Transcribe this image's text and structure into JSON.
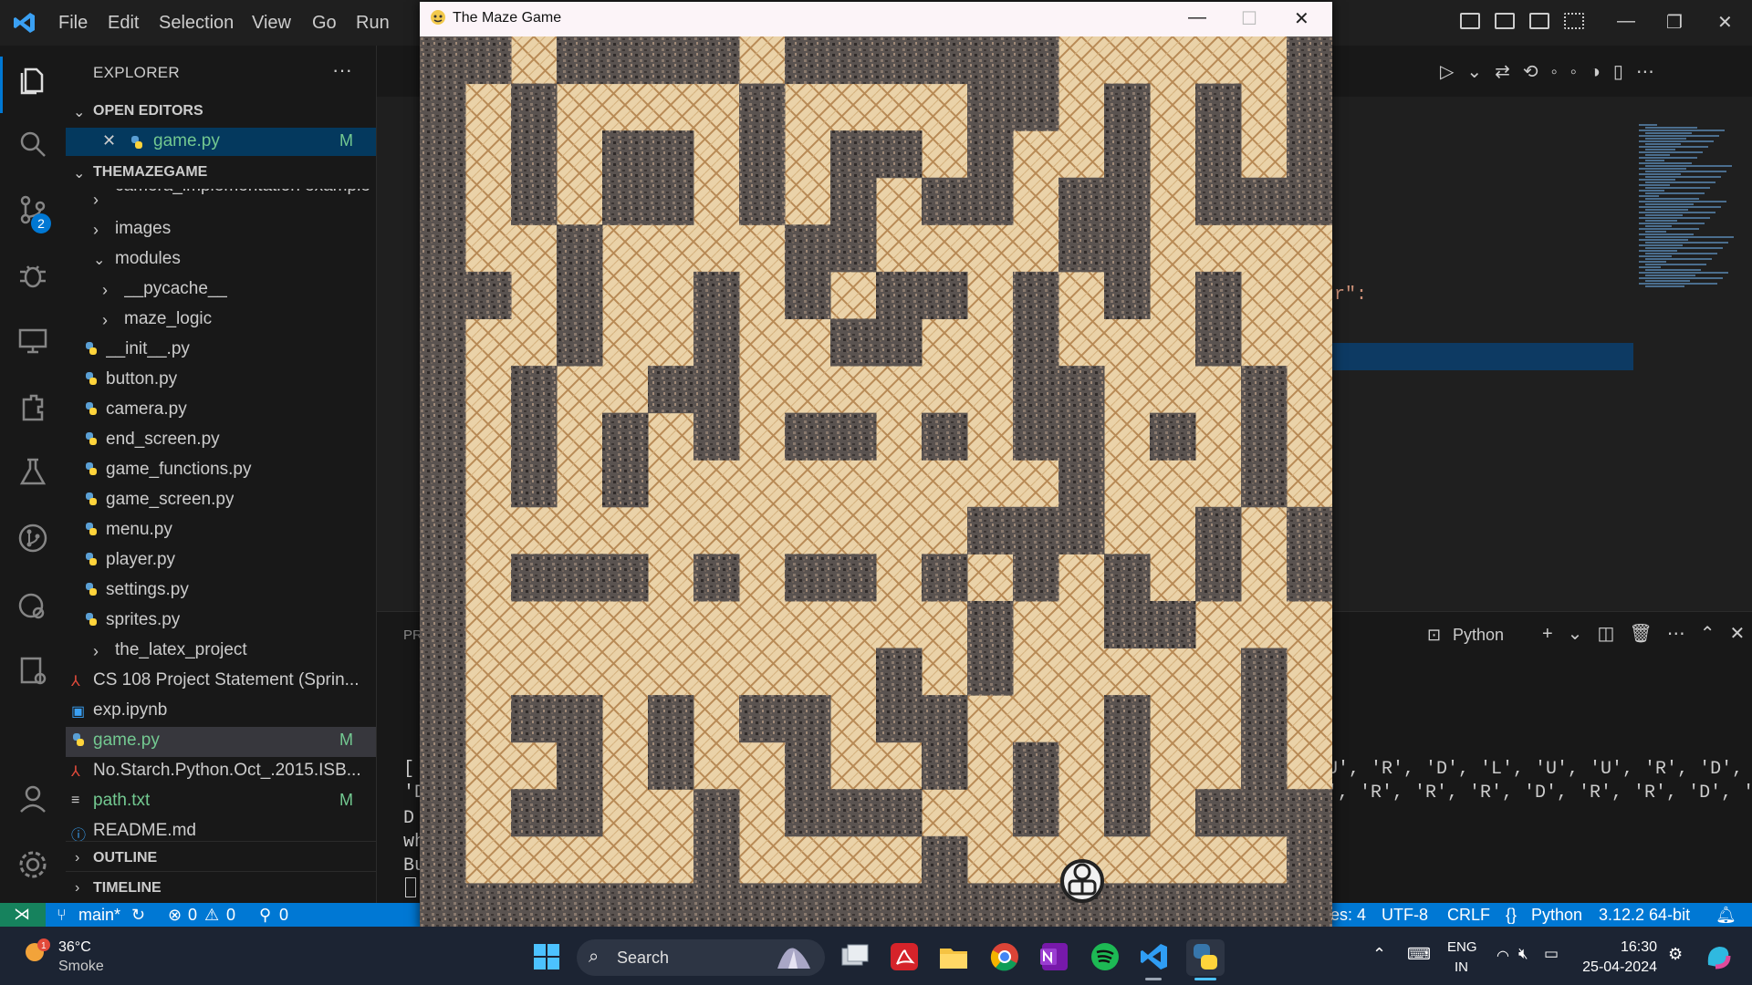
{
  "vscode": {
    "menu": [
      "File",
      "Edit",
      "Selection",
      "View",
      "Go",
      "Run",
      "…"
    ],
    "scm_badge": "2",
    "explorer": {
      "title": "EXPLORER",
      "more": "···",
      "open_editors_header": "OPEN EDITORS",
      "open_editor": {
        "name": "game.py",
        "status": "M"
      },
      "project_header": "THEMAZEGAME",
      "items": [
        {
          "label": "camera_implementation example",
          "kind": "folder"
        },
        {
          "label": "images",
          "kind": "folder"
        },
        {
          "label": "modules",
          "kind": "folder-open"
        },
        {
          "label": "__pycache__",
          "kind": "folder"
        },
        {
          "label": "maze_logic",
          "kind": "folder"
        },
        {
          "label": "__init__.py",
          "kind": "py"
        },
        {
          "label": "button.py",
          "kind": "py"
        },
        {
          "label": "camera.py",
          "kind": "py"
        },
        {
          "label": "end_screen.py",
          "kind": "py"
        },
        {
          "label": "game_functions.py",
          "kind": "py"
        },
        {
          "label": "game_screen.py",
          "kind": "py"
        },
        {
          "label": "menu.py",
          "kind": "py"
        },
        {
          "label": "player.py",
          "kind": "py"
        },
        {
          "label": "settings.py",
          "kind": "py"
        },
        {
          "label": "sprites.py",
          "kind": "py"
        },
        {
          "label": "the_latex_project",
          "kind": "folder"
        },
        {
          "label": "CS 108 Project Statement (Sprin...",
          "kind": "pdf"
        },
        {
          "label": "exp.ipynb",
          "kind": "file"
        },
        {
          "label": "game.py",
          "kind": "py",
          "status": "M"
        },
        {
          "label": "No.Starch.Python.Oct_.2015.ISB...",
          "kind": "pdf"
        },
        {
          "label": "path.txt",
          "kind": "txt",
          "status": "M"
        },
        {
          "label": "README.md",
          "kind": "info"
        }
      ],
      "outline_header": "OUTLINE",
      "timeline_header": "TIMELINE"
    },
    "editor": {
      "visible_code_fragment": "r\":"
    },
    "panel": {
      "tab_hint": "PR",
      "terminal_label": "Python",
      "terminal_lines": [
        "U', 'R', 'D', 'L', 'U', 'U', 'R', 'D',",
        "', 'R', 'R', 'R', 'D', 'R', 'R', 'D', '"
      ],
      "left_fragments": [
        "[",
        "'D",
        "D",
        "wh",
        "Bu"
      ]
    },
    "status": {
      "branch": "main*",
      "errors": "0",
      "warnings": "0",
      "ports": "0",
      "spaces": "es: 4",
      "encoding": "UTF-8",
      "eol": "CRLF",
      "language": "Python",
      "interpreter": "3.12.2 64-bit"
    }
  },
  "game_window": {
    "title": "The Maze Game",
    "maze_rows": [
      "##.####.######.....#",
      "#.#....#....##.#.#.#",
      "#.#.##.#.##.#..#.#.#",
      "#.#.##.#.#.##.##.###",
      "#..#....##....##....#",
      "##.#..#.#.##.#.#.#..",
      "#..#..#..##..#...#..",
      "#.#..##......##...#.",
      "#.#.#.#.##.#.##.#.#.",
      "#.#.#.........#...#.",
      "#...........###..#.#",
      "#.###.#.##.#.#.#.#.#",
      "#...........#..##...",
      "#.........#.#.....#.",
      "#.##.#.##.##...#..#.",
      "#..#.#..#..#.#.#..#.",
      "#.##..#.###..#.#.###",
      "#.....#....#.......#",
      "####################"
    ]
  },
  "taskbar": {
    "weather_temp": "36°C",
    "weather_desc": "Smoke",
    "search_label": "Search",
    "lang_line1": "ENG",
    "lang_line2": "IN",
    "time": "16:30",
    "date": "25-04-2024"
  },
  "colors": {
    "accent": "#0078d4",
    "modified": "#73c991",
    "wall": "#5d5a56",
    "path": "#e9cfa4"
  }
}
